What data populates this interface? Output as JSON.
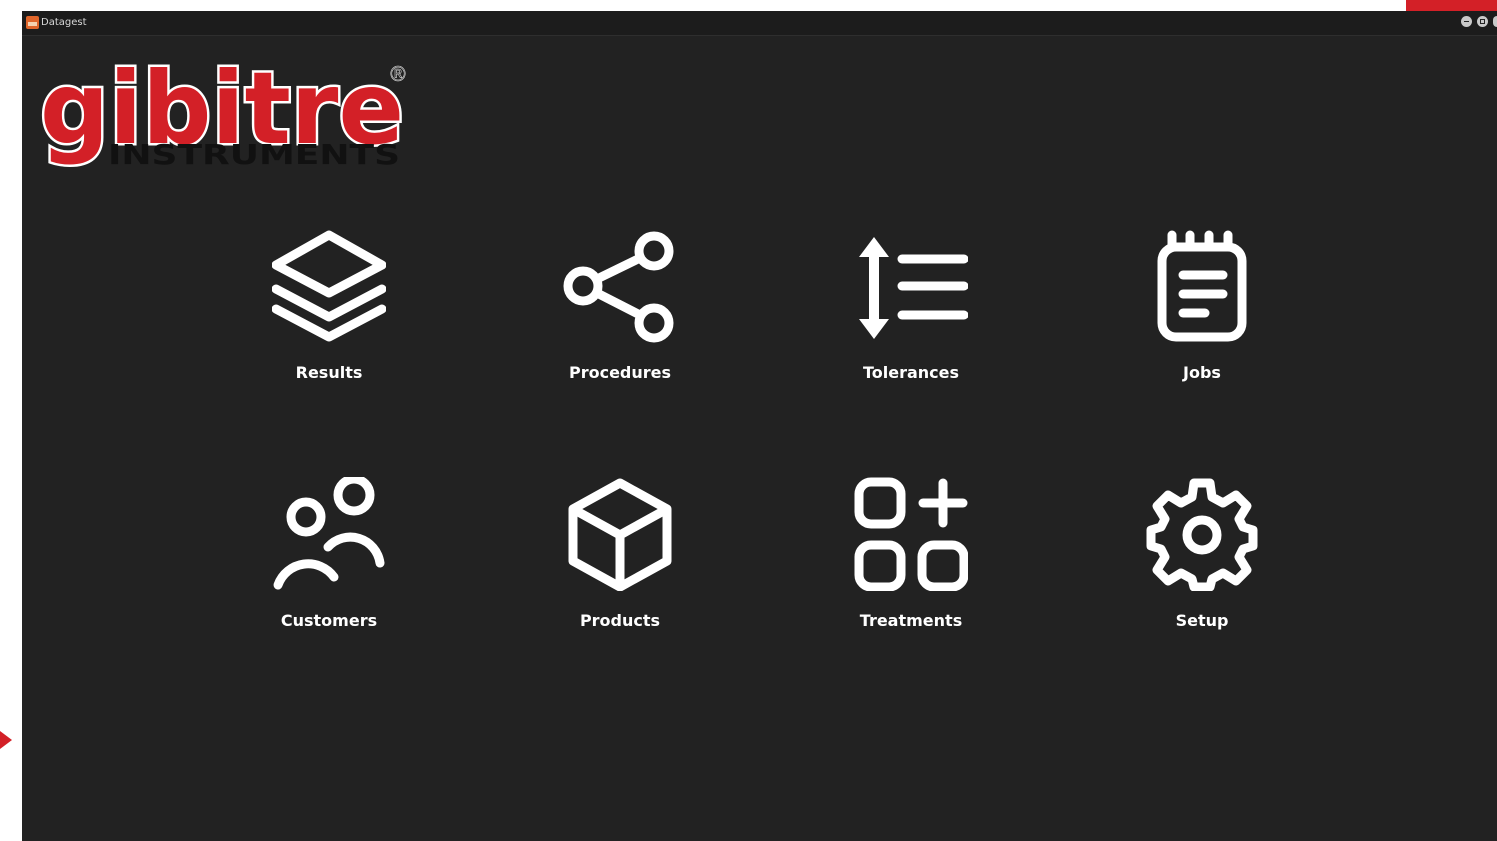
{
  "window": {
    "title": "Datagest"
  },
  "logo": {
    "brand_text": "gibitre",
    "sub_text": "INSTRUMENTS",
    "registered_mark": "®"
  },
  "menu": {
    "items": [
      {
        "label": "Results",
        "icon": "layers-icon"
      },
      {
        "label": "Procedures",
        "icon": "share-icon"
      },
      {
        "label": "Tolerances",
        "icon": "tolerance-list-icon"
      },
      {
        "label": "Jobs",
        "icon": "notepad-icon"
      },
      {
        "label": "Customers",
        "icon": "users-icon"
      },
      {
        "label": "Products",
        "icon": "box-icon"
      },
      {
        "label": "Treatments",
        "icon": "apps-add-icon"
      },
      {
        "label": "Setup",
        "icon": "gear-icon"
      }
    ]
  },
  "colors": {
    "background": "#222222",
    "foreground": "#ffffff",
    "brand_red": "#d32027",
    "titlebar": "#1c1c1c"
  }
}
